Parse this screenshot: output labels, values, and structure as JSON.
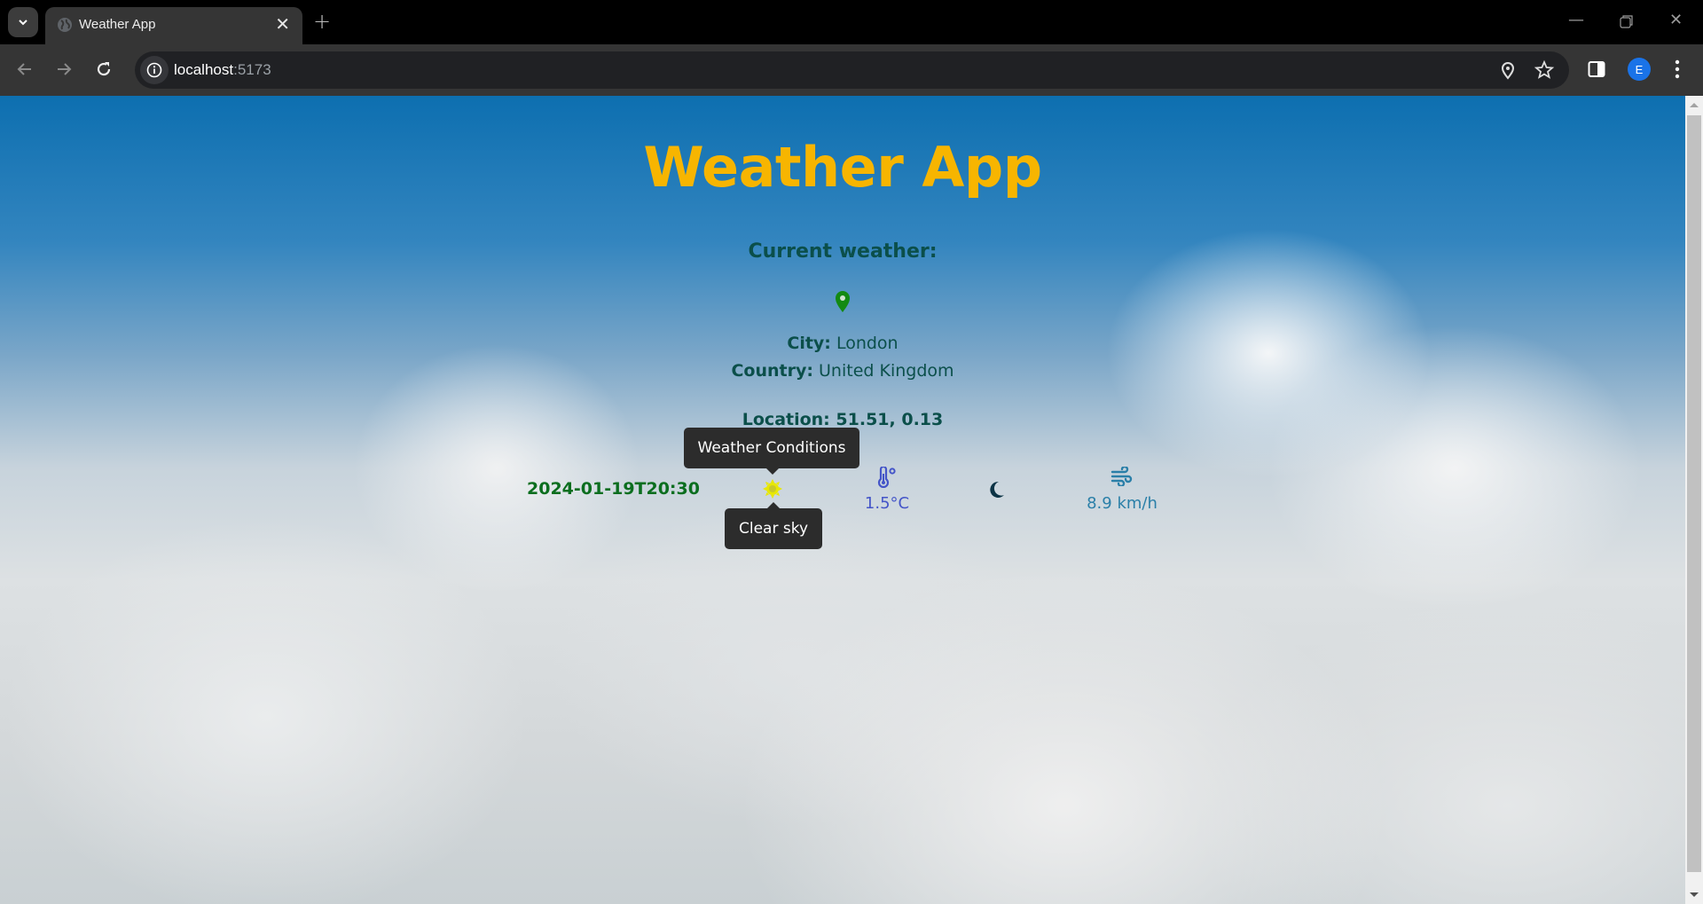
{
  "browser": {
    "tab_title": "Weather App",
    "url_host": "localhost",
    "url_port": ":5173",
    "profile_initial": "E",
    "icons": [
      "tab-search-icon",
      "globe-icon",
      "close-icon",
      "new-tab-icon",
      "minimize-icon",
      "restore-icon",
      "window-close-icon",
      "back-icon",
      "forward-icon",
      "reload-icon",
      "info-icon",
      "location-icon",
      "bookmark-star-icon",
      "side-panel-icon",
      "menu-kebab-icon"
    ]
  },
  "page": {
    "title": "Weather App",
    "subtitle": "Current weather:",
    "city_label": "City:",
    "city": "London",
    "country_label": "Country:",
    "country": "United Kingdom",
    "location_label": "Location:",
    "location": "51.51, 0.13",
    "datetime": "2024-01-19T20:30",
    "temperature": "1.5°C",
    "wind_speed": "8.9 km/h",
    "tooltip_top": "Weather Conditions",
    "tooltip_bottom": "Clear sky",
    "colors": {
      "title": "#f7b500",
      "text": "#0b4f4a",
      "date": "#0b6e1f",
      "pin": "#138a13",
      "sun": "#e8e800",
      "temperature": "#4455c8",
      "moon": "#0b3345",
      "wind": "#2a7fa8"
    }
  }
}
